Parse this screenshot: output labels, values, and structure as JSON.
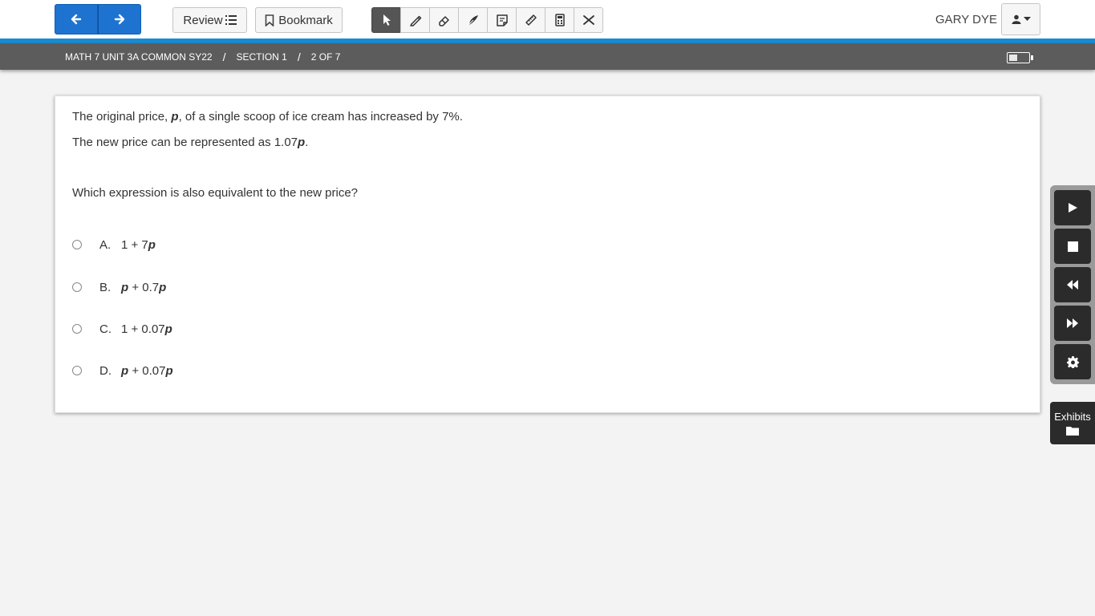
{
  "toolbar": {
    "review_label": "Review",
    "bookmark_label": "Bookmark",
    "tools": [
      "pointer-icon",
      "highlighter-icon",
      "eraser-icon",
      "strikethrough-icon",
      "notepad-icon",
      "ruler-icon",
      "calculator-icon",
      "answer-eliminator-icon"
    ],
    "active_tool": "pointer-icon"
  },
  "user": {
    "name": "GARY DYE"
  },
  "breadcrumb": {
    "test": "MATH 7 UNIT 3A COMMON SY22",
    "section": "SECTION 1",
    "position": "2 OF 7",
    "separator": "/"
  },
  "question": {
    "line1_pre": "The original price, ",
    "line1_var": "p",
    "line1_post": ", of a single scoop of ice cream has increased by 7%.",
    "line2_pre": "The new price can be represented as 1.07",
    "line2_var": "p",
    "line2_post": ".",
    "prompt": "Which expression is also equivalent to the new price?"
  },
  "options": [
    {
      "letter": "A.",
      "parts": [
        "1 + 7",
        "p"
      ]
    },
    {
      "letter": "B.",
      "parts": [
        "p",
        " + 0.7",
        "p"
      ]
    },
    {
      "letter": "C.",
      "parts": [
        "1 + 0.07",
        "p"
      ]
    },
    {
      "letter": "D.",
      "parts": [
        "p",
        " + 0.07",
        "p"
      ]
    }
  ],
  "side_panel": {
    "buttons": [
      "play-icon",
      "stop-icon",
      "rewind-icon",
      "fast-forward-icon",
      "gear-icon"
    ],
    "exhibits_label": "Exhibits"
  },
  "colors": {
    "accent": "#1a8bd1",
    "nav_button": "#1e73d0",
    "breadcrumb_bar": "#5c5c5c",
    "panel_button": "#2b2b2b"
  }
}
